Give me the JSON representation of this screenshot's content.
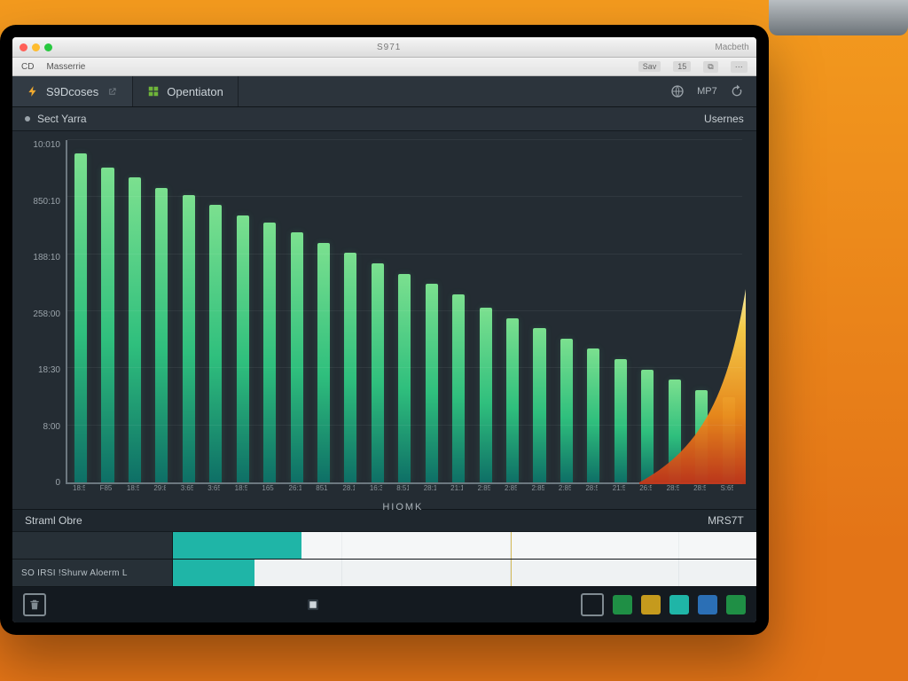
{
  "os": {
    "title": "S971",
    "right_label": "Macbeth",
    "menu_items": [
      "CD",
      "Masserrie"
    ],
    "menu_right": [
      "Sav",
      "15",
      "⧉",
      "⋯"
    ]
  },
  "tabs": {
    "primary": "S9Dcoses",
    "secondary": "Opentiaton",
    "tool_label": "MP7"
  },
  "subheader": {
    "left": "Sect Yarra",
    "right": "Usernes"
  },
  "panel": {
    "title_left": "Straml Obre",
    "title_right": "MRS7T",
    "track1_label": "",
    "track2_label": "SO IRSI !Shurw Aloerm L",
    "track1_fill_pct": 22,
    "track2_fill_pct": 14
  },
  "chart_data": {
    "type": "bar",
    "title": "",
    "xlabel": "HIOMK",
    "ylabel": "",
    "ylim": [
      0,
      10000
    ],
    "y_ticks": [
      "0",
      "8:00",
      "18:30",
      "258:00",
      "188:10",
      "850:10",
      "10:010"
    ],
    "categories": [
      "18:55",
      "F85",
      "18:53",
      "29:8",
      "3:65",
      "3:65",
      "18:5",
      "165",
      "26:1",
      "851",
      "28.1",
      "16:31",
      "8:51",
      "28:1",
      "21:1",
      "2:85",
      "2:85",
      "2:85",
      "2:85",
      "28:5",
      "21:5",
      "26:5",
      "28:5",
      "28:5",
      "S:65"
    ],
    "values": [
      9600,
      9200,
      8900,
      8600,
      8400,
      8100,
      7800,
      7600,
      7300,
      7000,
      6700,
      6400,
      6100,
      5800,
      5500,
      5100,
      4800,
      4500,
      4200,
      3900,
      3600,
      3300,
      3000,
      2700,
      2500
    ]
  },
  "dock": {
    "left_items": [
      "trash-icon"
    ],
    "center_items": [
      "app-icon"
    ],
    "right_items": [
      "display-icon",
      "terminal-green-icon",
      "chart-icon",
      "monitor-teal-icon",
      "window-green-icon"
    ]
  },
  "colors": {
    "bar_top": "#7be08f",
    "bar_bottom": "#0e6f66",
    "panel_fill": "#1fb5a7",
    "bg_dark": "#242c33"
  }
}
